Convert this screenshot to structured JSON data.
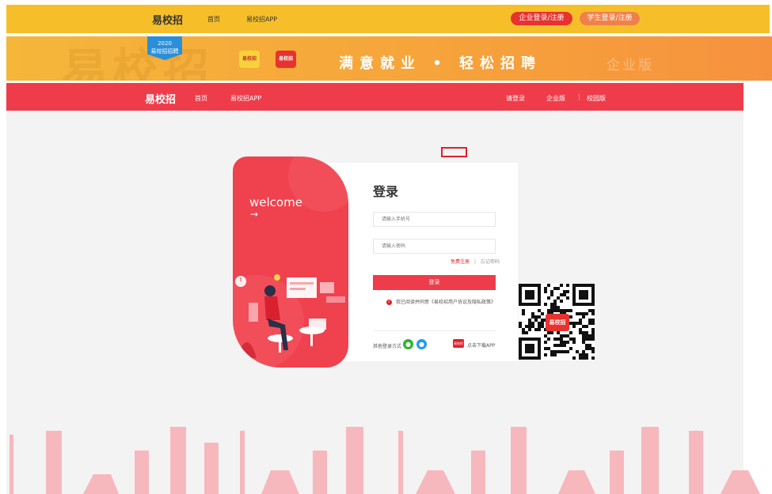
{
  "topbar": {
    "logo": "易校招",
    "home": "首页",
    "app": "易校招APP",
    "enterprise_login": "企业登录/注册",
    "student_login": "学生登录/注册"
  },
  "banner": {
    "ghost_text": "易校招",
    "badge_year": "2020",
    "badge_text": "易校招招聘",
    "app_icon_1": "易校招",
    "app_icon_2": "易校招",
    "slogan": "满意就业 • 轻松招聘",
    "edition": "企业版"
  },
  "rednav": {
    "logo": "易校招",
    "home": "首页",
    "app": "易校招APP",
    "please_login": "请登录",
    "enterprise": "企业版",
    "campus": "校园版"
  },
  "login": {
    "welcome": "welcome",
    "arrow": "→",
    "title": "登录",
    "phone_placeholder": "请输入手机号",
    "password_placeholder": "请输入密码",
    "register": "免费注册",
    "separator": "|",
    "forgot": "忘记密码",
    "submit": "登录",
    "agreement": "我已阅读并同意《易校招用户协议及隐私政策》",
    "other_methods": "其他登录方式",
    "download_icon": "易校招",
    "download_app": "点击下载APP"
  },
  "qr": {
    "logo": "易校招"
  },
  "colors": {
    "brand_red": "#ef3c4a",
    "top_yellow": "#f6bf2a",
    "banner_orange": "#f6a43b",
    "wechat_green": "#2cb52c",
    "qq_blue": "#1e9df1"
  },
  "icons": [
    "wechat-icon",
    "qq-icon",
    "check-icon",
    "arrow-right-icon",
    "qr-code-icon",
    "app-download-icon"
  ]
}
